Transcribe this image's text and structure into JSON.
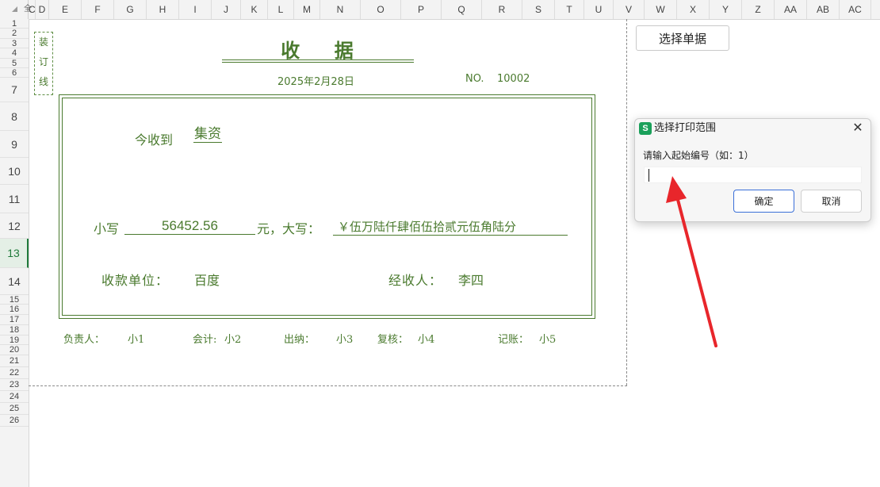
{
  "sheet": {
    "columns": [
      "C",
      "D",
      "E",
      "F",
      "G",
      "H",
      "I",
      "J",
      "K",
      "L",
      "M",
      "N",
      "O",
      "P",
      "Q",
      "R",
      "S",
      "T",
      "U",
      "V",
      "W",
      "X",
      "Y",
      "Z",
      "AA",
      "AB",
      "AC"
    ],
    "rows": [
      "1",
      "2",
      "3",
      "4",
      "5",
      "6",
      "7",
      "8",
      "9",
      "10",
      "11",
      "12",
      "13",
      "14",
      "15",
      "16",
      "17",
      "18",
      "19",
      "20",
      "21",
      "22",
      "23",
      "24",
      "25",
      "26"
    ],
    "selected_row": "13",
    "corner_label": "全"
  },
  "receipt": {
    "binding_chars": [
      "装",
      "订",
      "线"
    ],
    "title": "收    据",
    "date": "2025年2月28日",
    "no_label": "NO.",
    "no_value": "10002",
    "received_from_label": "今收到",
    "received_from_value": "集资",
    "small_label": "小写",
    "amount": "56452.56",
    "yuan_label": "元，大写：",
    "amount_words": "￥伍万陆仟肆佰伍拾贰元伍角陆分",
    "unit_label": "收款单位：",
    "unit_value": "百度",
    "handler_label": "经收人：",
    "handler_value": "李四",
    "signatures": [
      {
        "label": "负责人：",
        "value": "小1"
      },
      {
        "label": "会计:",
        "value": "小2"
      },
      {
        "label": "出纳：",
        "value": "小3"
      },
      {
        "label": "复核：",
        "value": "小4"
      },
      {
        "label": "记账：",
        "value": "小5"
      }
    ],
    "color": "#4a7a2e"
  },
  "button": {
    "label": "选择单据"
  },
  "dialog": {
    "icon_letter": "S",
    "title": "选择打印范围",
    "close": "✕",
    "prompt": "请输入起始编号（如：1）",
    "input_value": "",
    "ok_label": "确定",
    "cancel_label": "取消",
    "icon_color": "#1aa05a"
  },
  "annotation": {
    "arrow_color": "#e8262b"
  }
}
